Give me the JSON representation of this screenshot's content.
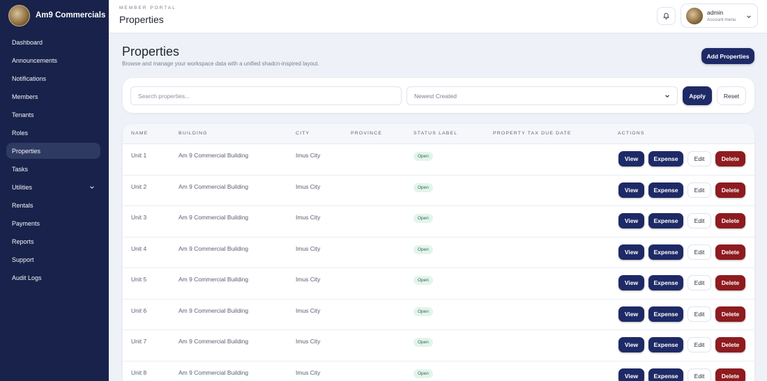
{
  "brand": {
    "name": "Am9 Commercials"
  },
  "sidebar": {
    "items": [
      {
        "label": "Dashboard"
      },
      {
        "label": "Announcements"
      },
      {
        "label": "Notifications"
      },
      {
        "label": "Members"
      },
      {
        "label": "Tenants"
      },
      {
        "label": "Roles"
      },
      {
        "label": "Properties",
        "active": true
      },
      {
        "label": "Tasks"
      },
      {
        "label": "Utilities",
        "has_submenu": true
      },
      {
        "label": "Rentals"
      },
      {
        "label": "Payments"
      },
      {
        "label": "Reports"
      },
      {
        "label": "Support"
      },
      {
        "label": "Audit Logs"
      }
    ]
  },
  "topbar": {
    "eyebrow": "MEMBER PORTAL",
    "title": "Properties",
    "account": {
      "name": "admin",
      "subtitle": "Account menu"
    }
  },
  "page": {
    "title": "Properties",
    "subtitle": "Browse and manage your workspace data with a unified shadcn-inspired layout.",
    "add_button": "Add Properties"
  },
  "filters": {
    "search_placeholder": "Search properties...",
    "search_value": "",
    "sort_selected": "Newest Created",
    "apply_label": "Apply",
    "reset_label": "Reset"
  },
  "table": {
    "columns": [
      "NAME",
      "BUILDING",
      "CITY",
      "PROVINCE",
      "STATUS LABEL",
      "PROPERTY TAX DUE DATE",
      "ACTIONS"
    ],
    "actions": {
      "view": "View",
      "expense": "Expense",
      "edit": "Edit",
      "delete": "Delete"
    },
    "rows": [
      {
        "name": "Unit 1",
        "building": "Am 9 Commercial Building",
        "city": "Imus City",
        "province": "",
        "status": "Open",
        "tax_due": ""
      },
      {
        "name": "Unit 2",
        "building": "Am 9 Commercial Building",
        "city": "Imus City",
        "province": "",
        "status": "Open",
        "tax_due": ""
      },
      {
        "name": "Unit 3",
        "building": "Am 9 Commercial Building",
        "city": "Imus City",
        "province": "",
        "status": "Open",
        "tax_due": ""
      },
      {
        "name": "Unit 4",
        "building": "Am 9 Commercial Building",
        "city": "Imus City",
        "province": "",
        "status": "Open",
        "tax_due": ""
      },
      {
        "name": "Unit 5",
        "building": "Am 9 Commercial Building",
        "city": "Imus City",
        "province": "",
        "status": "Open",
        "tax_due": ""
      },
      {
        "name": "Unit 6",
        "building": "Am 9 Commercial Building",
        "city": "Imus City",
        "province": "",
        "status": "Open",
        "tax_due": ""
      },
      {
        "name": "Unit 7",
        "building": "Am 9 Commercial Building",
        "city": "Imus City",
        "province": "",
        "status": "Open",
        "tax_due": ""
      },
      {
        "name": "Unit 8",
        "building": "Am 9 Commercial Building",
        "city": "Imus City",
        "province": "",
        "status": "Open",
        "tax_due": ""
      }
    ]
  },
  "colors": {
    "sidebar_bg": "#18224a",
    "primary": "#1e2a66",
    "danger": "#8e1b1f",
    "status_open_bg": "#e3f4ec",
    "page_bg": "#eef1f7"
  }
}
